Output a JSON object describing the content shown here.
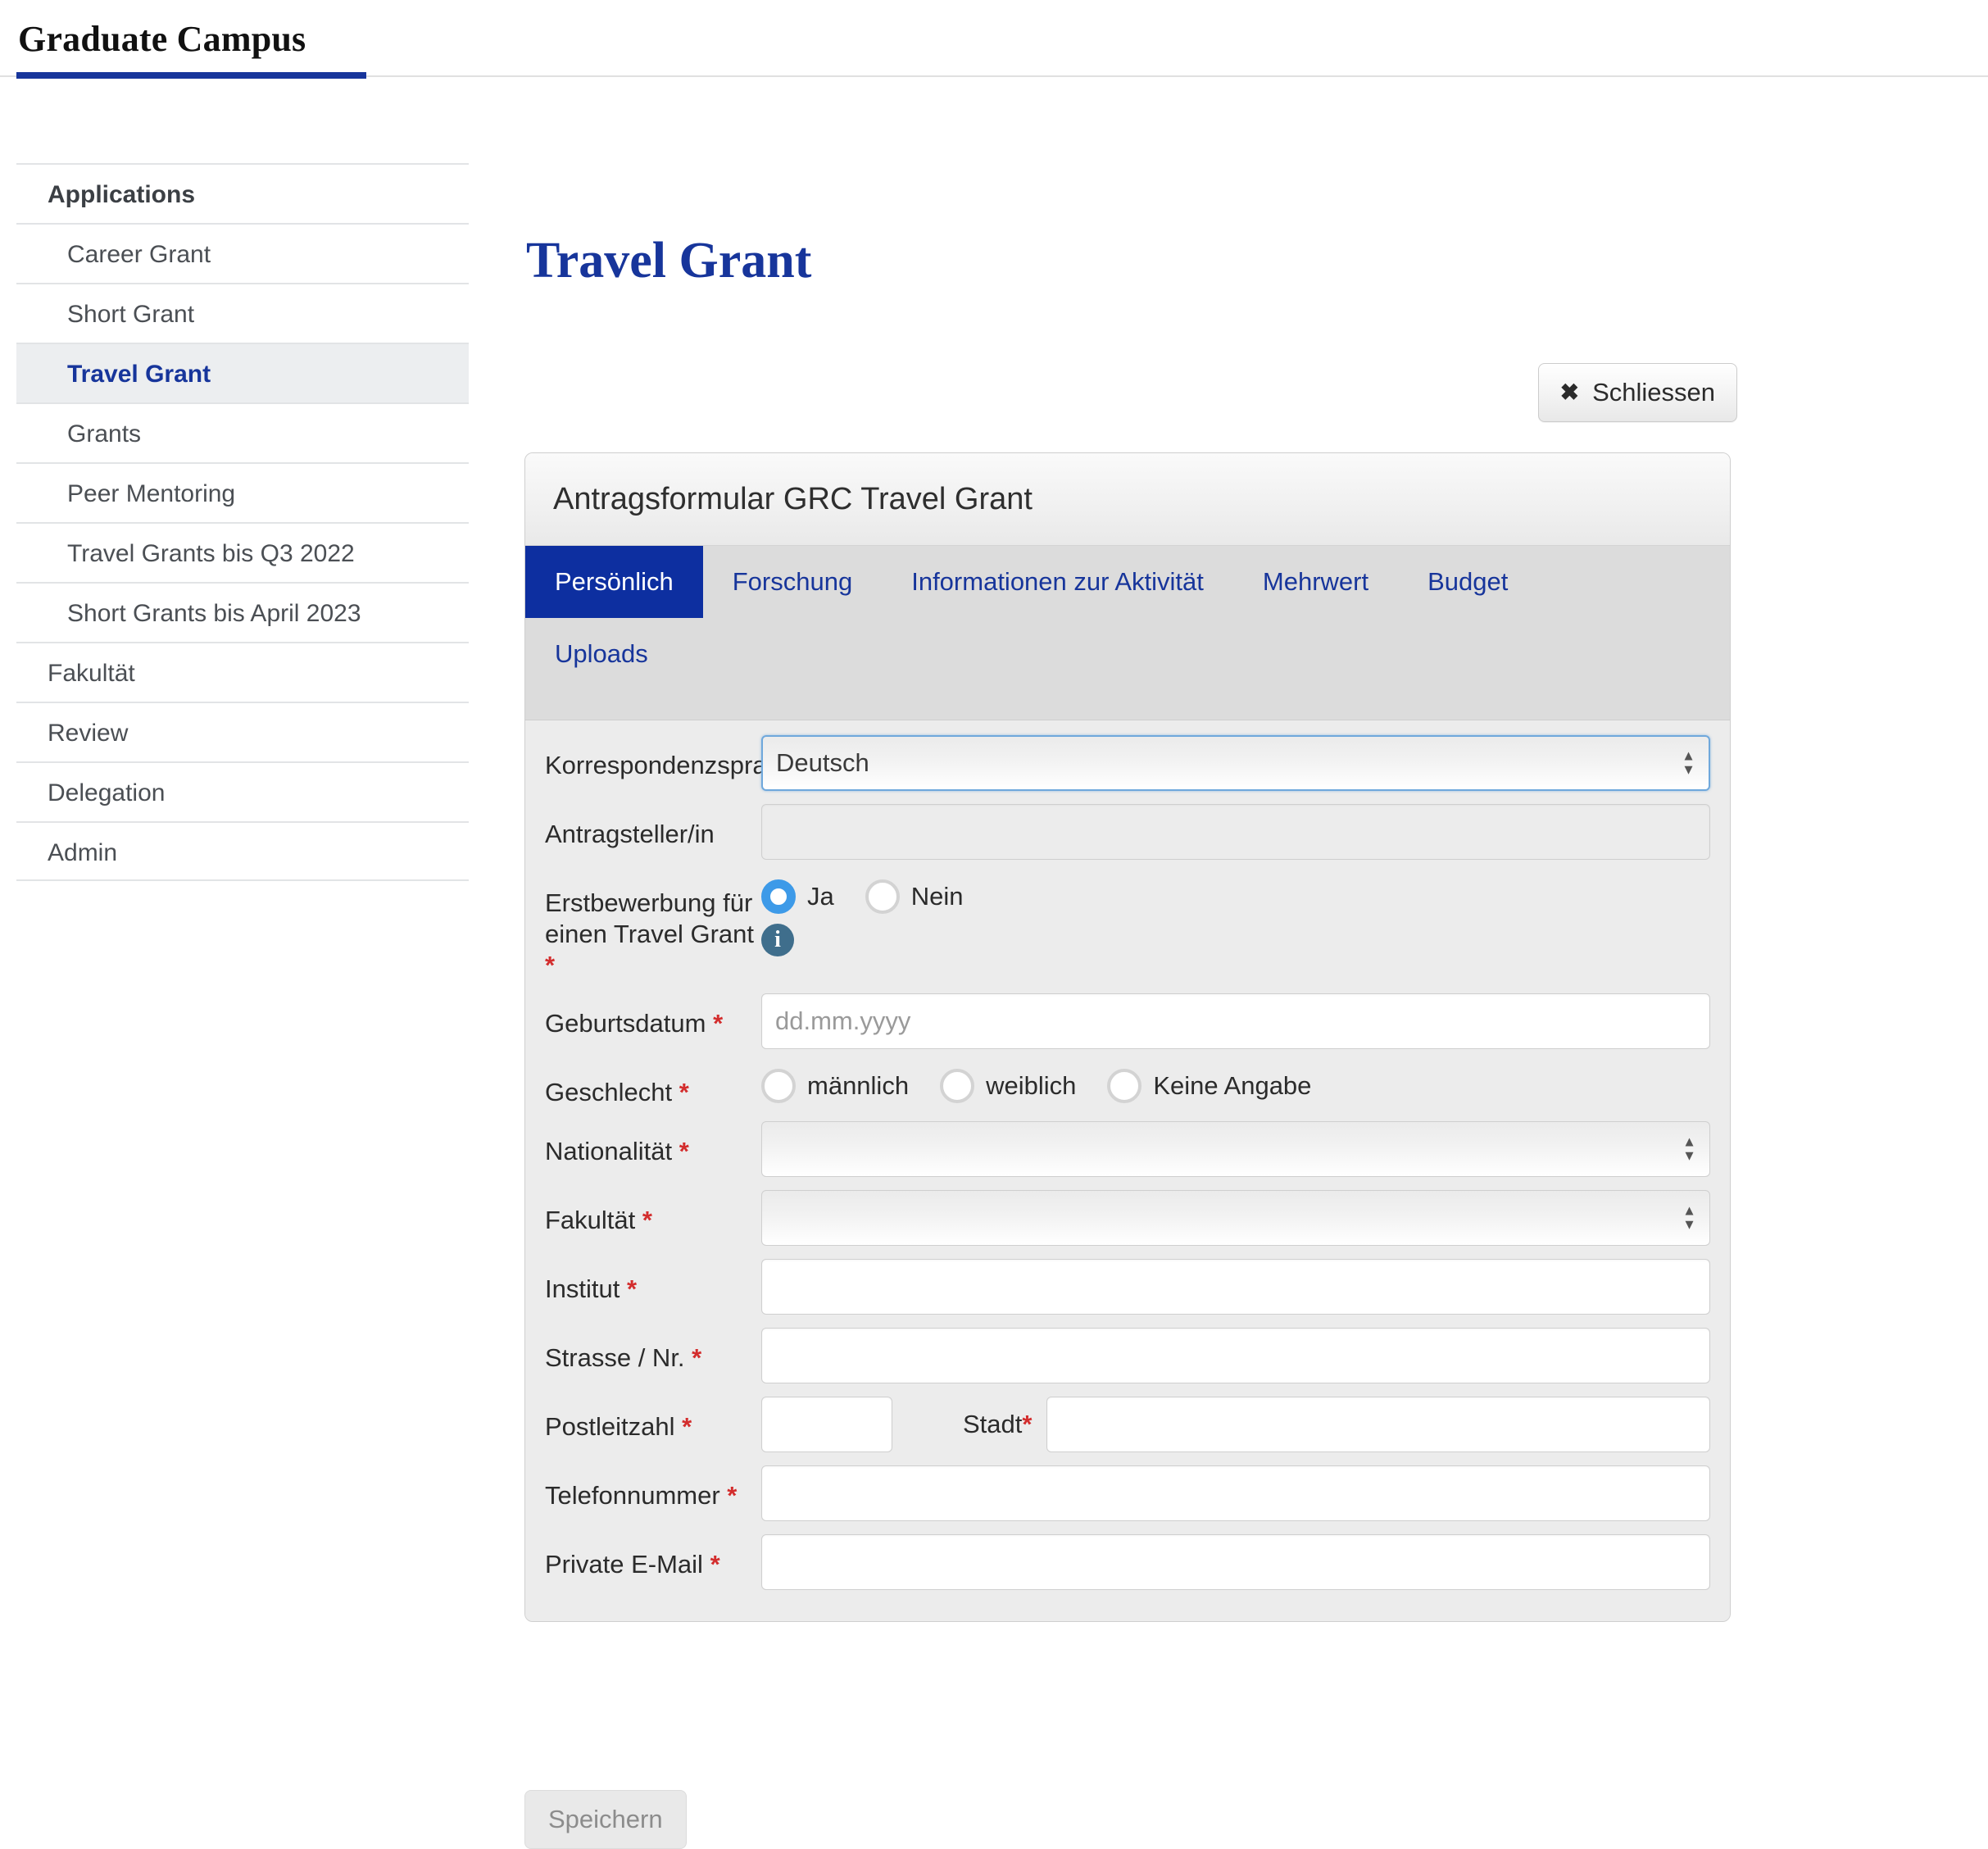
{
  "brand": {
    "title": "Graduate Campus"
  },
  "sidebar": {
    "items": [
      {
        "label": "Applications",
        "type": "group"
      },
      {
        "label": "Career Grant",
        "type": "child"
      },
      {
        "label": "Short Grant",
        "type": "child"
      },
      {
        "label": "Travel Grant",
        "type": "child",
        "active": true
      },
      {
        "label": "Grants",
        "type": "child"
      },
      {
        "label": "Peer Mentoring",
        "type": "child"
      },
      {
        "label": "Travel Grants bis Q3 2022",
        "type": "child"
      },
      {
        "label": "Short Grants bis April 2023",
        "type": "child"
      },
      {
        "label": "Fakultät",
        "type": "group-plain"
      },
      {
        "label": "Review",
        "type": "group-plain"
      },
      {
        "label": "Delegation",
        "type": "group-plain"
      },
      {
        "label": "Admin",
        "type": "group-plain"
      }
    ]
  },
  "main": {
    "page_title": "Travel Grant",
    "close_button": {
      "label": "Schliessen",
      "icon": "close-x-icon"
    },
    "panel_title": "Antragsformular GRC Travel Grant",
    "tabs": [
      {
        "label": "Persönlich",
        "active": true
      },
      {
        "label": "Forschung",
        "active": false
      },
      {
        "label": "Informationen zur Aktivität",
        "active": false
      },
      {
        "label": "Mehrwert",
        "active": false
      },
      {
        "label": "Budget",
        "active": false
      },
      {
        "label": "Uploads",
        "active": false
      }
    ],
    "save_button": {
      "label": "Speichern"
    }
  },
  "form": {
    "korrespondenzsprache": {
      "label": "Korrespondenzsprache",
      "value": "Deutsch"
    },
    "antragsteller": {
      "label": "Antragsteller/in",
      "value": "",
      "placeholder": ""
    },
    "erstbewerbung": {
      "label": "Erstbewerbung für einen Travel Grant",
      "required": "*",
      "options": [
        {
          "label": "Ja",
          "checked": true
        },
        {
          "label": "Nein",
          "checked": false
        }
      ],
      "info_icon": "info-icon"
    },
    "geburtsdatum": {
      "label": "Geburtsdatum",
      "required": "*",
      "value": "",
      "placeholder": "dd.mm.yyyy"
    },
    "geschlecht": {
      "label": "Geschlecht",
      "required": "*",
      "options": [
        {
          "label": "männlich",
          "checked": false
        },
        {
          "label": "weiblich",
          "checked": false
        },
        {
          "label": "Keine Angabe",
          "checked": false
        }
      ]
    },
    "nationalitaet": {
      "label": "Nationalität",
      "required": "*",
      "value": ""
    },
    "fakultaet": {
      "label": "Fakultät",
      "required": "*",
      "value": ""
    },
    "institut": {
      "label": "Institut",
      "required": "*",
      "value": "",
      "placeholder": ""
    },
    "strasse": {
      "label": "Strasse / Nr.",
      "required": "*",
      "value": "",
      "placeholder": ""
    },
    "postleitzahl": {
      "label": "Postleitzahl",
      "required": "*",
      "value": "",
      "placeholder": ""
    },
    "stadt": {
      "label": "Stadt",
      "required": "*",
      "value": "",
      "placeholder": ""
    },
    "telefonnummer": {
      "label": "Telefonnummer",
      "required": "*",
      "value": "",
      "placeholder": ""
    },
    "email": {
      "label": "Private E-Mail",
      "required": "*",
      "value": "",
      "placeholder": ""
    }
  },
  "colors": {
    "brand_blue": "#17359b",
    "tab_active": "#0d2fa0",
    "required_red": "#d32d2d",
    "radio_checked": "#3d9ae8",
    "info_icon": "#3f6e8c"
  }
}
